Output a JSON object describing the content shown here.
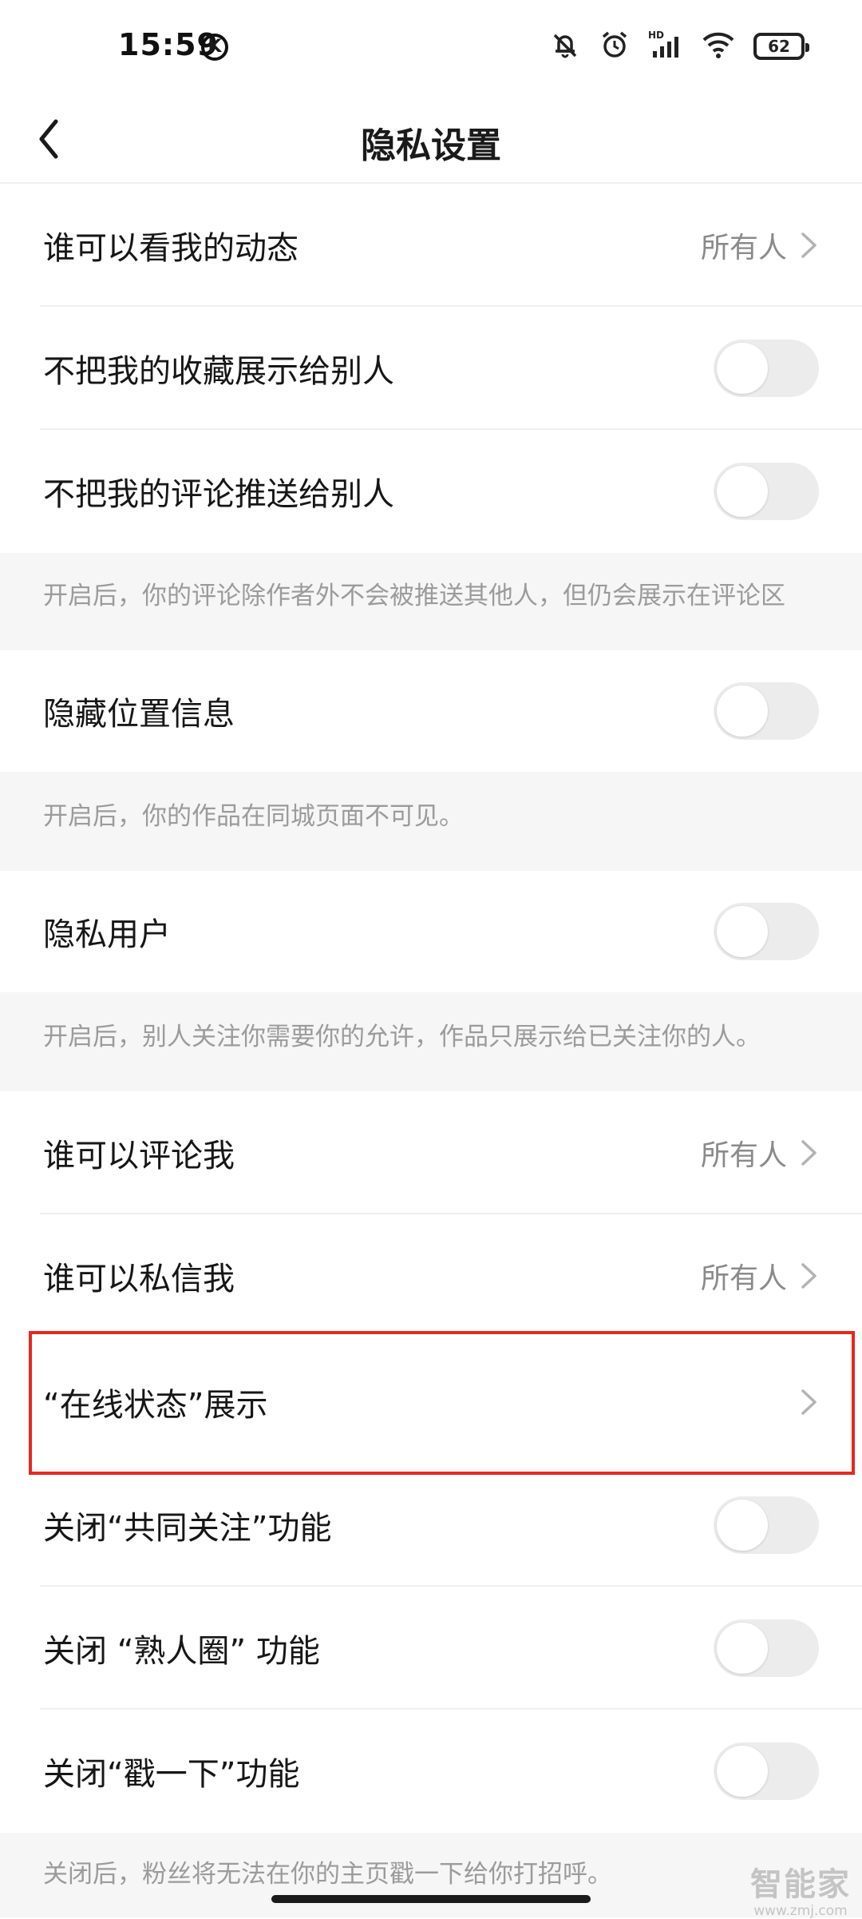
{
  "status_bar": {
    "time": "15:59",
    "k_badge": "K",
    "battery": "62",
    "icons": [
      "notifications-off-icon",
      "alarm-icon",
      "hd-signal-icon",
      "wifi-icon",
      "battery-icon"
    ],
    "hd_label": "HD"
  },
  "header": {
    "title": "隐私设置",
    "back_icon": "chevron-left-icon"
  },
  "rows": {
    "who_can_see_activity": {
      "label": "谁可以看我的动态",
      "value": "所有人"
    },
    "hide_favorites": {
      "label": "不把我的收藏展示给别人",
      "toggle": false
    },
    "hide_comments": {
      "label": "不把我的评论推送给别人",
      "toggle": false
    },
    "hide_location": {
      "label": "隐藏位置信息",
      "toggle": false
    },
    "private_user": {
      "label": "隐私用户",
      "toggle": false
    },
    "who_can_comment": {
      "label": "谁可以评论我",
      "value": "所有人"
    },
    "who_can_message": {
      "label": "谁可以私信我",
      "value": "所有人"
    },
    "online_status": {
      "label": "“在线状态”展示"
    },
    "close_mutual_follow": {
      "label": "关闭“共同关注”功能",
      "toggle": false
    },
    "close_acquaintance": {
      "label": "关闭 “熟人圈” 功能",
      "toggle": false
    },
    "close_poke": {
      "label": "关闭“戳一下”功能",
      "toggle": false
    }
  },
  "notes": {
    "comments_note": "开启后，你的评论除作者外不会被推送其他人，但仍会展示在评论区",
    "location_note": "开启后，你的作品在同城页面不可见。",
    "private_note": "开启后，别人关注你需要你的允许，作品只展示给已关注你的人。",
    "poke_note": "关闭后，粉丝将无法在你的主页戳一下给你打招呼。"
  },
  "highlight_color": "#e6281e",
  "toggle_off_color": "#ececec",
  "watermark": {
    "main": "智能家",
    "sub": "www.zmj.com"
  }
}
